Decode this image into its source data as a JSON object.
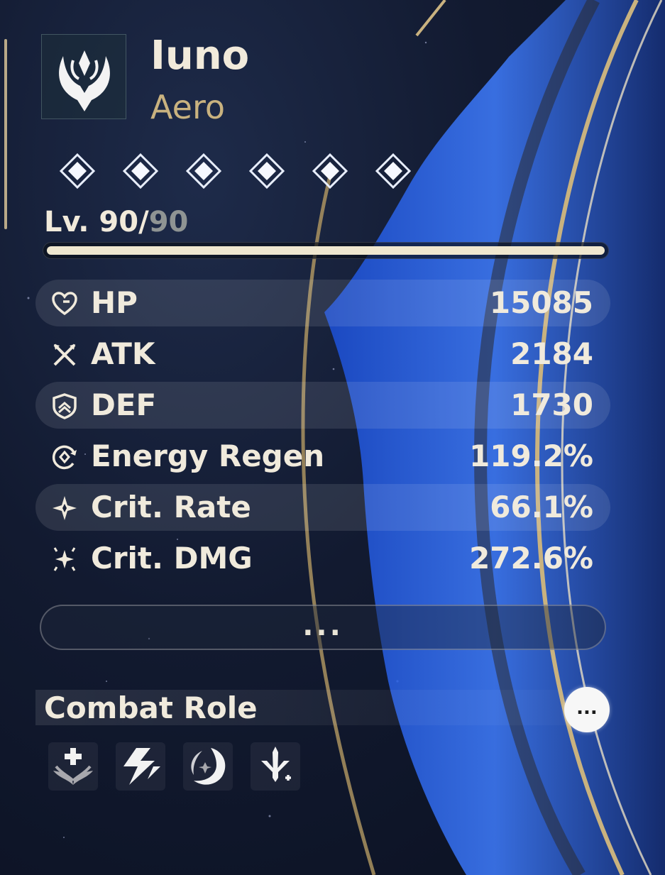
{
  "character": {
    "name": "Iuno",
    "element": "Aero",
    "emblem_icon": "aero-emblem-icon",
    "sequence_nodes": 6
  },
  "level": {
    "prefix": "Lv. ",
    "current": "90",
    "separator": "/",
    "max": "90",
    "progress_fraction": 1.0
  },
  "stats": [
    {
      "icon": "heart-hp-icon",
      "label": "HP",
      "value": "15085"
    },
    {
      "icon": "crossed-swords-icon",
      "label": "ATK",
      "value": "2184"
    },
    {
      "icon": "shield-icon",
      "label": "DEF",
      "value": "1730"
    },
    {
      "icon": "energy-cycle-icon",
      "label": "Energy Regen",
      "value": "119.2%"
    },
    {
      "icon": "sparkle-icon",
      "label": "Crit. Rate",
      "value": "66.1%"
    },
    {
      "icon": "multi-sparkle-icon",
      "label": "Crit. DMG",
      "value": "272.6%"
    }
  ],
  "more_button": {
    "label": "..."
  },
  "combat_role": {
    "title": "Combat Role",
    "more_label": "...",
    "icons": [
      "healing-wings-icon",
      "lightning-burst-icon",
      "crescent-swirl-icon",
      "sword-plus-icon"
    ]
  },
  "colors": {
    "accent_gold": "#c9b27f",
    "text_primary": "#f0eadc",
    "muted": "#8f9493",
    "crystal_blue": "#2f6be0"
  }
}
